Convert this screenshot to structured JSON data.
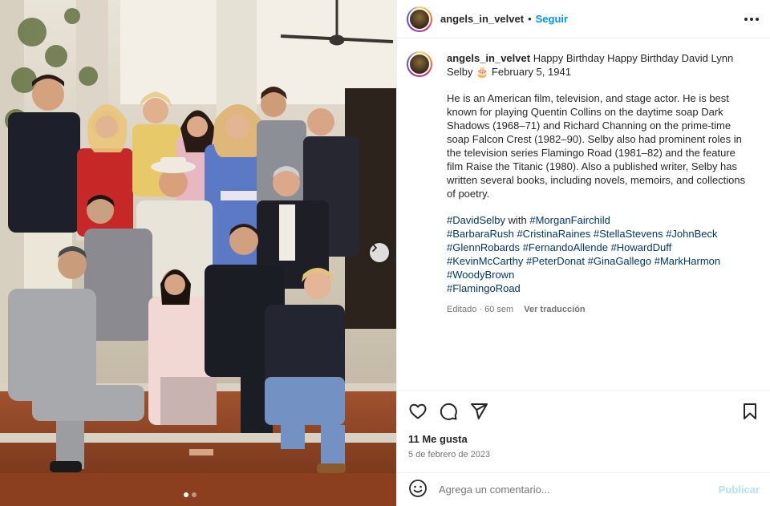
{
  "post": {
    "username": "angels_in_velvet",
    "separator": "•",
    "follow_label": "Seguir",
    "caption_first_line": "Happy Birthday Happy Birthday David Lynn Selby 🎂 February 5, 1941",
    "caption_body": "He is an American film, television, and stage actor. He is best known for playing Quentin Collins on the daytime soap Dark Shadows (1968–71) and Richard Channing on the prime-time soap Falcon Crest (1982–90). Selby also had prominent roles in the television series Flamingo Road (1981–82) and the feature film Raise the Titanic (1980). Also a published writer, Selby has written several books, including novels, memoirs, and collections of poetry.",
    "hashtags": [
      "#DavidSelby",
      "#MorganFairchild",
      "#BarbaraRush",
      "#CristinaRaines",
      "#StellaStevens",
      "#JohnBeck",
      "#GlennRobards",
      "#FernandoAllende",
      "#HowardDuff",
      "#KevinMcCarthy",
      "#PeterDonat",
      "#GinaGallego",
      "#MarkHarmon",
      "#WoodyBrown",
      "#FlamingoRoad"
    ],
    "hashtag_with": "with",
    "edited_label": "Editado · 60 sem",
    "translate_label": "Ver traducción",
    "likes_label": "11 Me gusta",
    "date_label": "5 de febrero de 2023",
    "comment_placeholder": "Agrega un comentario...",
    "publish_label": "Publicar"
  },
  "carousel": {
    "current": 1,
    "total": 2
  },
  "icons": [
    "heart-icon",
    "comment-icon",
    "share-icon",
    "save-icon",
    "emoji-icon",
    "more-icon",
    "chevron-right-icon"
  ],
  "colors": {
    "accent": "#0095f6",
    "hashtag": "#00376b",
    "muted": "#737373",
    "publish_disabled": "#b2dffc"
  }
}
